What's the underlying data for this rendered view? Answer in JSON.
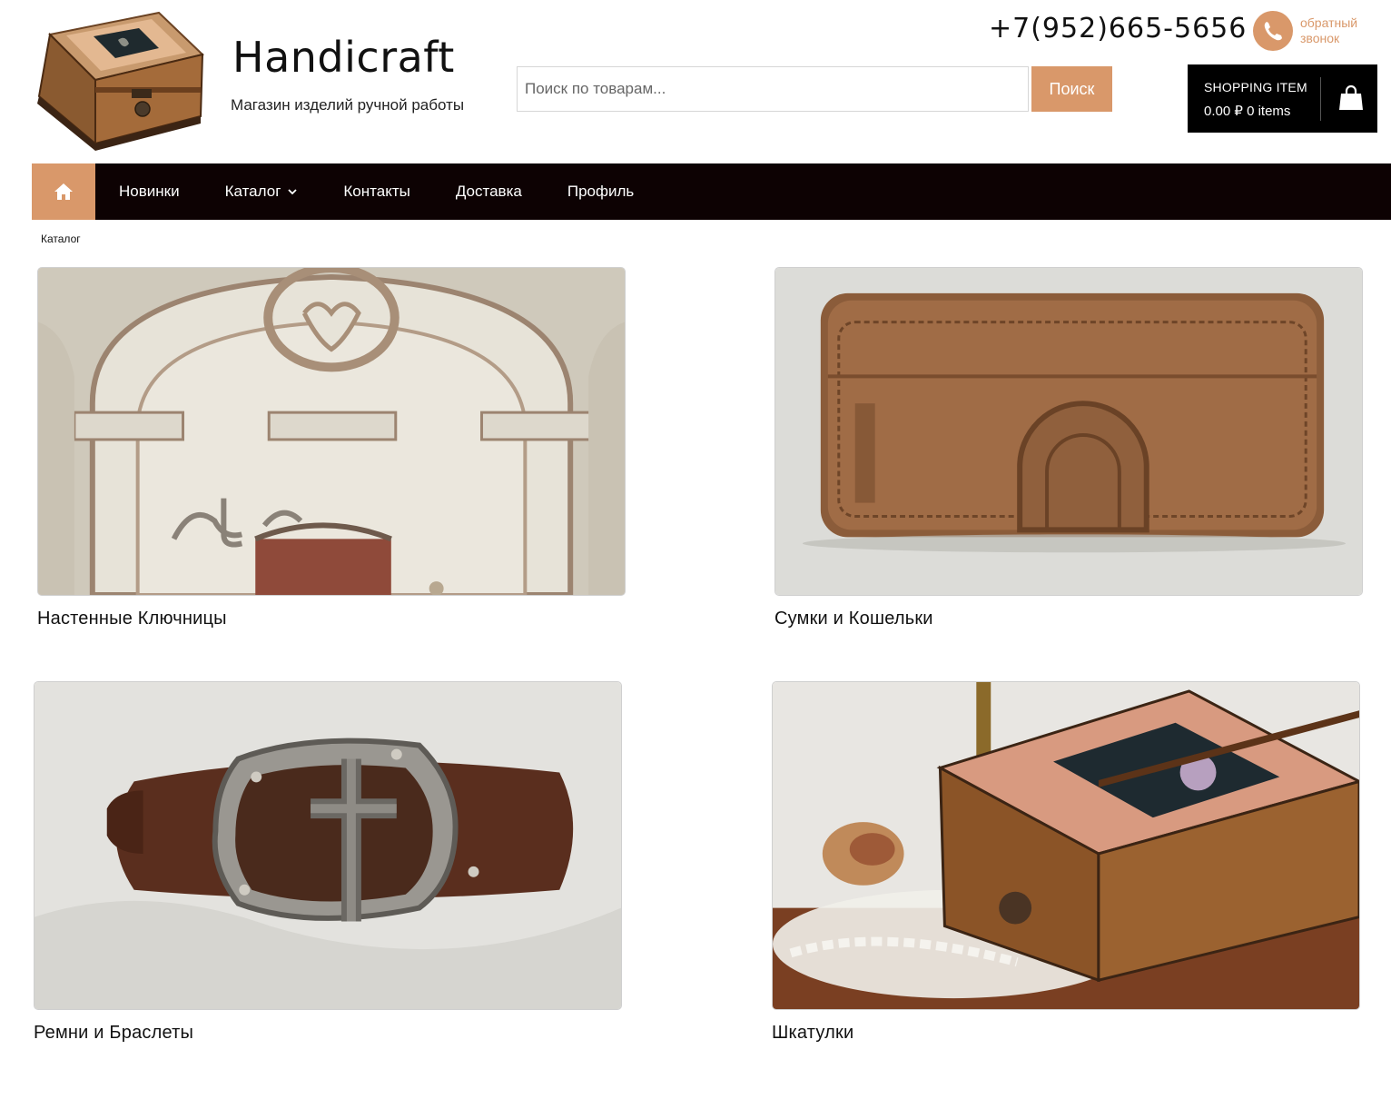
{
  "header": {
    "site_title": "Handicraft",
    "tagline": "Магазин изделий ручной работы",
    "phone": "+7(952)665-5656",
    "callback_label": "обратный звонок",
    "search": {
      "placeholder": "Поиск по товарам...",
      "button_label": "Поиск"
    },
    "cart": {
      "title": "SHOPPING ITEM",
      "total": "0.00 ₽ 0 items",
      "icon": "shopping-bag-icon"
    }
  },
  "nav": {
    "home_icon": "home-icon",
    "items": [
      {
        "label": "Новинки"
      },
      {
        "label": "Каталог"
      },
      {
        "label": "Контакты"
      },
      {
        "label": "Доставка"
      },
      {
        "label": "Профиль"
      }
    ]
  },
  "breadcrumb": "Каталог",
  "categories": [
    {
      "title": "Настенные Ключницы"
    },
    {
      "title": "Сумки и Кошельки"
    },
    {
      "title": "Ремни и Браслеты"
    },
    {
      "title": "Шкатулки"
    }
  ],
  "colors": {
    "accent": "#d9986a",
    "nav_bg": "#0d0203",
    "cart_bg": "#000000"
  }
}
